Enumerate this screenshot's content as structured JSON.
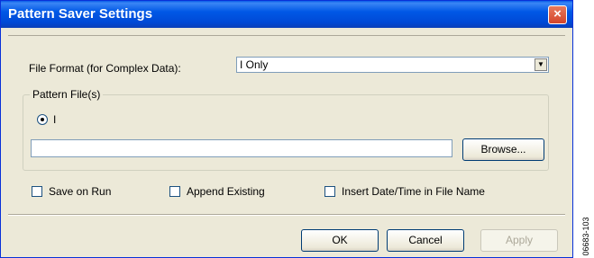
{
  "window": {
    "title": "Pattern Saver Settings",
    "close_glyph": "×"
  },
  "file_format": {
    "label": "File Format (for Complex Data):",
    "selected": "I Only"
  },
  "pattern_group": {
    "legend": "Pattern File(s)",
    "radio_label": "I",
    "path_value": "",
    "browse_label": "Browse..."
  },
  "options": {
    "save_on_run": {
      "label": "Save on Run",
      "checked": false
    },
    "append_existing": {
      "label": "Append Existing",
      "checked": false
    },
    "insert_datetime": {
      "label": "Insert Date/Time in File Name",
      "checked": false
    }
  },
  "buttons": {
    "ok": "OK",
    "cancel": "Cancel",
    "apply": "Apply"
  },
  "figure_id": "06683-103",
  "colors": {
    "titlebar": "#0058e6",
    "dialog_bg": "#ece9d8",
    "close": "#d4452a"
  }
}
